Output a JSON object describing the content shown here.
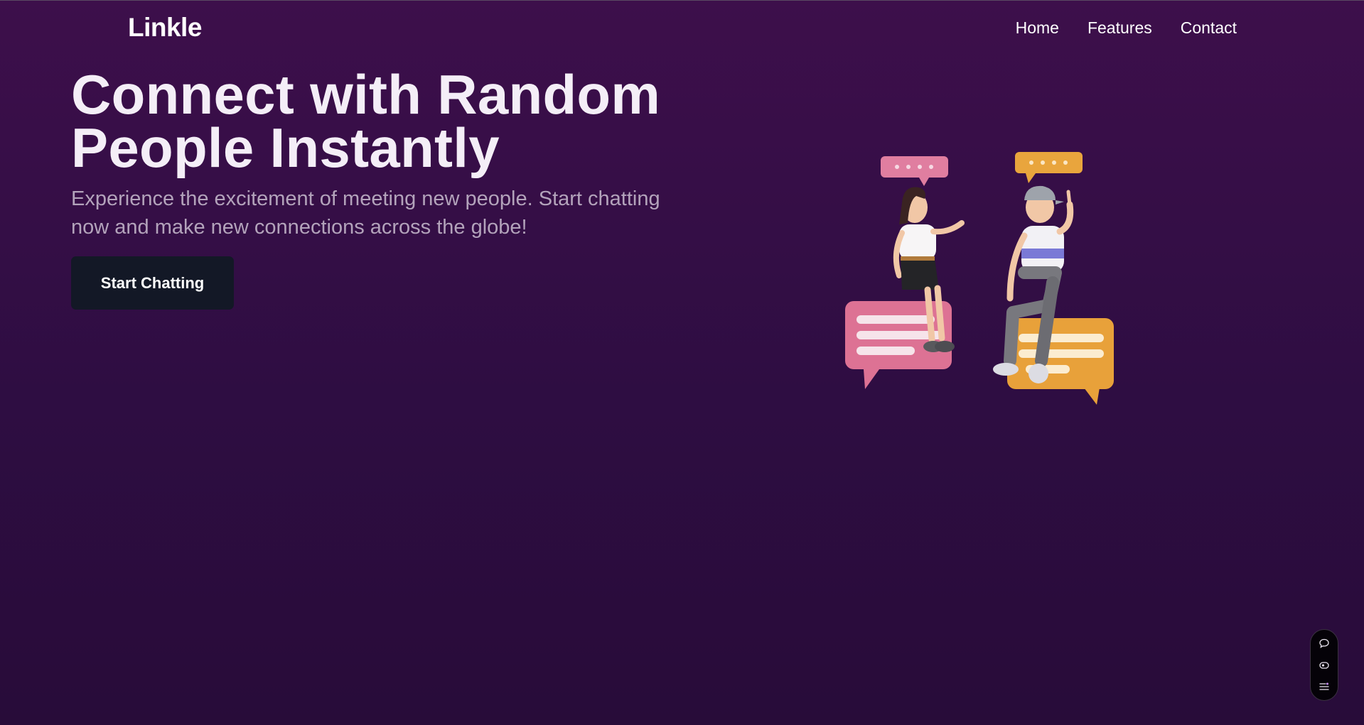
{
  "nav": {
    "brand": "Linkle",
    "links": [
      "Home",
      "Features",
      "Contact"
    ]
  },
  "hero": {
    "title_line1": "Connect with Random",
    "title_line2": "People Instantly",
    "subtitle": "Experience the excitement of meeting new people. Start chatting now and make new connections across the globe!",
    "cta_label": "Start Chatting"
  },
  "toolbar": {
    "icons": [
      "chat-bubble-icon",
      "eye-icon",
      "list-settings-icon"
    ]
  },
  "colors": {
    "background_top": "#3d0f4b",
    "background_bottom": "#280c39",
    "button": "#131826",
    "subtitle_text": "#b3a3bb",
    "pink_bubble": "#e2799a",
    "orange_bubble": "#e8a43e"
  }
}
